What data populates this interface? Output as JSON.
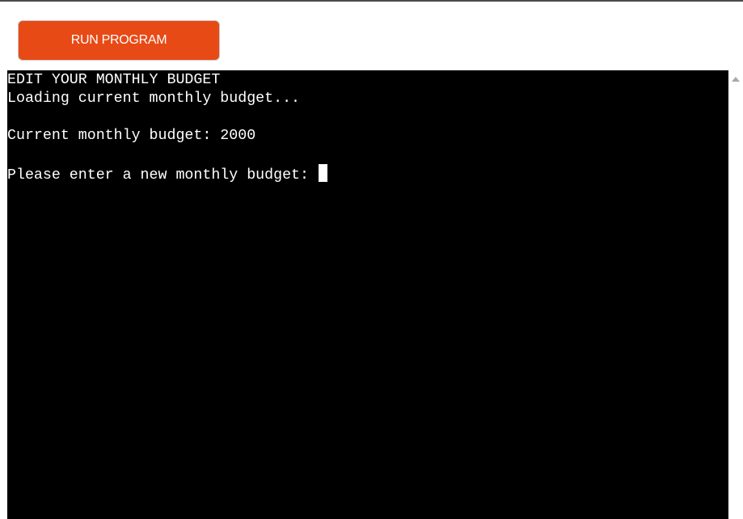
{
  "toolbar": {
    "run_label": "RUN PROGRAM",
    "run_color": "#e84a16"
  },
  "terminal": {
    "lines": [
      "EDIT YOUR MONTHLY BUDGET",
      "Loading current monthly budget...",
      "",
      "Current monthly budget: 2000",
      "",
      "Please enter a new monthly budget: "
    ],
    "background": "#000000",
    "foreground": "#ffffff"
  },
  "scrollbar": {
    "up_icon": "triangle-up-icon"
  }
}
